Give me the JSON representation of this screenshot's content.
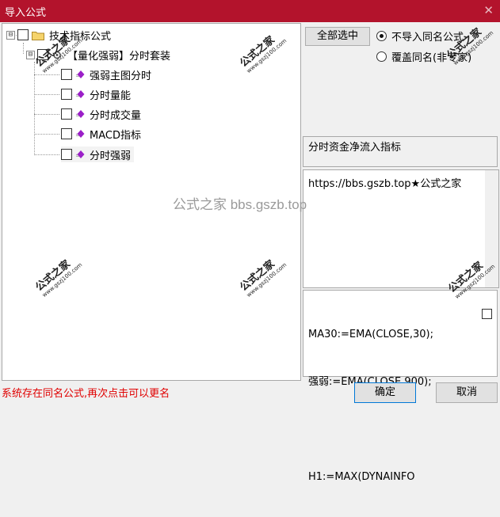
{
  "window": {
    "title": "导入公式",
    "close_glyph": "✕"
  },
  "tree": {
    "root": {
      "label": "技术指标公式",
      "expander": "⊟"
    },
    "group": {
      "label": "【量化强弱】分时套装",
      "expander": "⊟"
    },
    "items": [
      {
        "label": "强弱主图分时"
      },
      {
        "label": "分时量能"
      },
      {
        "label": "分时成交量"
      },
      {
        "label": "MACD指标"
      },
      {
        "label": "分时强弱"
      }
    ]
  },
  "buttons": {
    "select_all": "全部选中",
    "ok": "确定",
    "cancel": "取消"
  },
  "options": {
    "no_import_same": "不导入同名公式",
    "overwrite_same": "覆盖同名(非专家)",
    "selected": "no_import_same"
  },
  "panels": {
    "name": "分时资金净流入指标",
    "description": "https://bbs.gszb.top★公式之家",
    "code_lines": [
      "MA30:=EMA(CLOSE,30);",
      "强弱:=EMA(CLOSE,900);",
      "",
      "H1:=MAX(DYNAINFO"
    ]
  },
  "status": "系统存在同名公式,再次点击可以更名",
  "watermark": {
    "center": "公式之家 bbs.gszb.top",
    "stamp_cn": "公式之家",
    "stamp_url": "www.gszj100.com"
  },
  "colors": {
    "titlebar": "#b3132c",
    "status_text": "#e00000",
    "diamond": "#9b1fc8",
    "folder": "#f5d36b"
  }
}
